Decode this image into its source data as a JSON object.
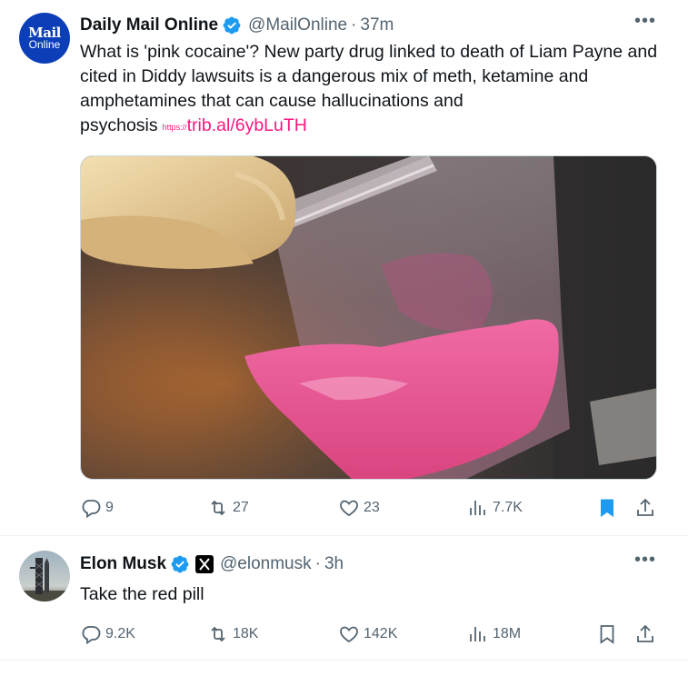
{
  "tweets": [
    {
      "avatar_logo": {
        "top": "Mail",
        "bottom": "Online"
      },
      "name": "Daily Mail Online",
      "handle": "@MailOnline",
      "separator": "·",
      "time": "37m",
      "text": "What is 'pink cocaine'? New party drug linked to death of Liam Payne and cited in Diddy lawsuits is a dangerous mix of meth, ketamine and amphetamines that can cause hallucinations and psychosis",
      "link_prefix": "https://",
      "link": "trib.al/6ybLuTH",
      "media_icon": "photo-pink-powder-bag",
      "stats": {
        "replies": "9",
        "reposts": "27",
        "likes": "23",
        "views": "7.7K"
      },
      "bookmarked": true
    },
    {
      "name": "Elon Musk",
      "handle": "@elonmusk",
      "separator": "·",
      "time": "3h",
      "text": "Take the red pill",
      "stats": {
        "replies": "9.2K",
        "reposts": "18K",
        "likes": "142K",
        "views": "18M"
      },
      "bookmarked": false
    }
  ],
  "colors": {
    "verified": "#1d9bf0",
    "link": "#f91880",
    "muted": "#536471",
    "bookmark_active": "#1d9bf0"
  }
}
